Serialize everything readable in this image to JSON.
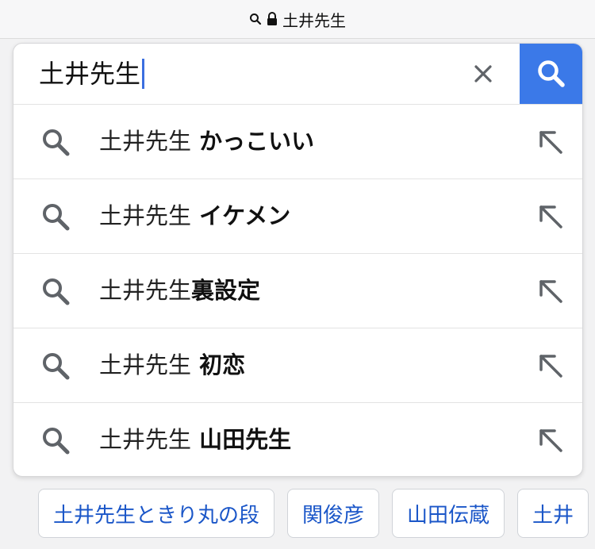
{
  "address_bar": {
    "title": "土井先生",
    "search_icon": "search-icon",
    "lock_icon": "lock-icon"
  },
  "search": {
    "query": "土井先生",
    "clear_icon": "close-icon",
    "submit_icon": "search-icon",
    "accent_color": "#3b79e8"
  },
  "suggestions": [
    {
      "base": "土井先生",
      "bold": " かっこいい"
    },
    {
      "base": "土井先生",
      "bold": " イケメン"
    },
    {
      "base": "土井先生",
      "bold": "裏設定"
    },
    {
      "base": "土井先生",
      "bold": " 初恋"
    },
    {
      "base": "土井先生",
      "bold": " 山田先生"
    }
  ],
  "related_chips": [
    "土井先生ときり丸の段",
    "関俊彦",
    "山田伝蔵",
    "土井"
  ]
}
